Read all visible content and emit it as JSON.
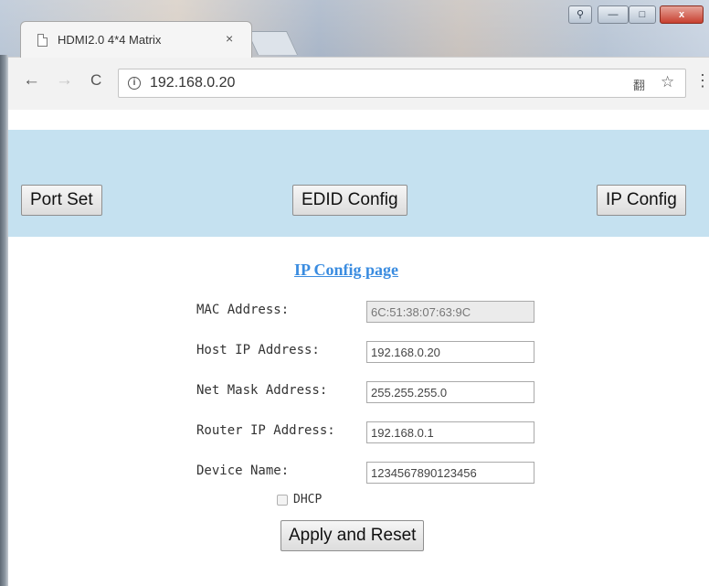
{
  "browser": {
    "tab_title": "HDMI2.0 4*4 Matrix",
    "tab_close": "×",
    "url": "192.168.0.20",
    "nav": {
      "back": "←",
      "forward": "→",
      "reload": "C"
    },
    "icons": {
      "info": "i",
      "translate": "翻",
      "star": "☆",
      "menu": "⋮"
    },
    "window_controls": {
      "user": "⚲",
      "minimize": "—",
      "maximize": "□",
      "close": "x"
    }
  },
  "navbar": {
    "port_set": "Port Set",
    "edid_config": "EDID Config",
    "ip_config": "IP Config"
  },
  "form": {
    "title": "IP Config page",
    "fields": [
      {
        "label": "MAC Address:",
        "value": "6C:51:38:07:63:9C",
        "readonly": true
      },
      {
        "label": "Host IP Address:",
        "value": "192.168.0.20"
      },
      {
        "label": "Net Mask Address:",
        "value": "255.255.255.0"
      },
      {
        "label": "Router IP Address:",
        "value": "192.168.0.1"
      },
      {
        "label": "Device Name:",
        "value": "1234567890123456"
      }
    ],
    "dhcp_label": "DHCP",
    "dhcp_checked": false,
    "apply_button": "Apply and Reset"
  },
  "colors": {
    "navbar_bg": "#c5e1f0",
    "title_link": "#3a8ce0"
  }
}
